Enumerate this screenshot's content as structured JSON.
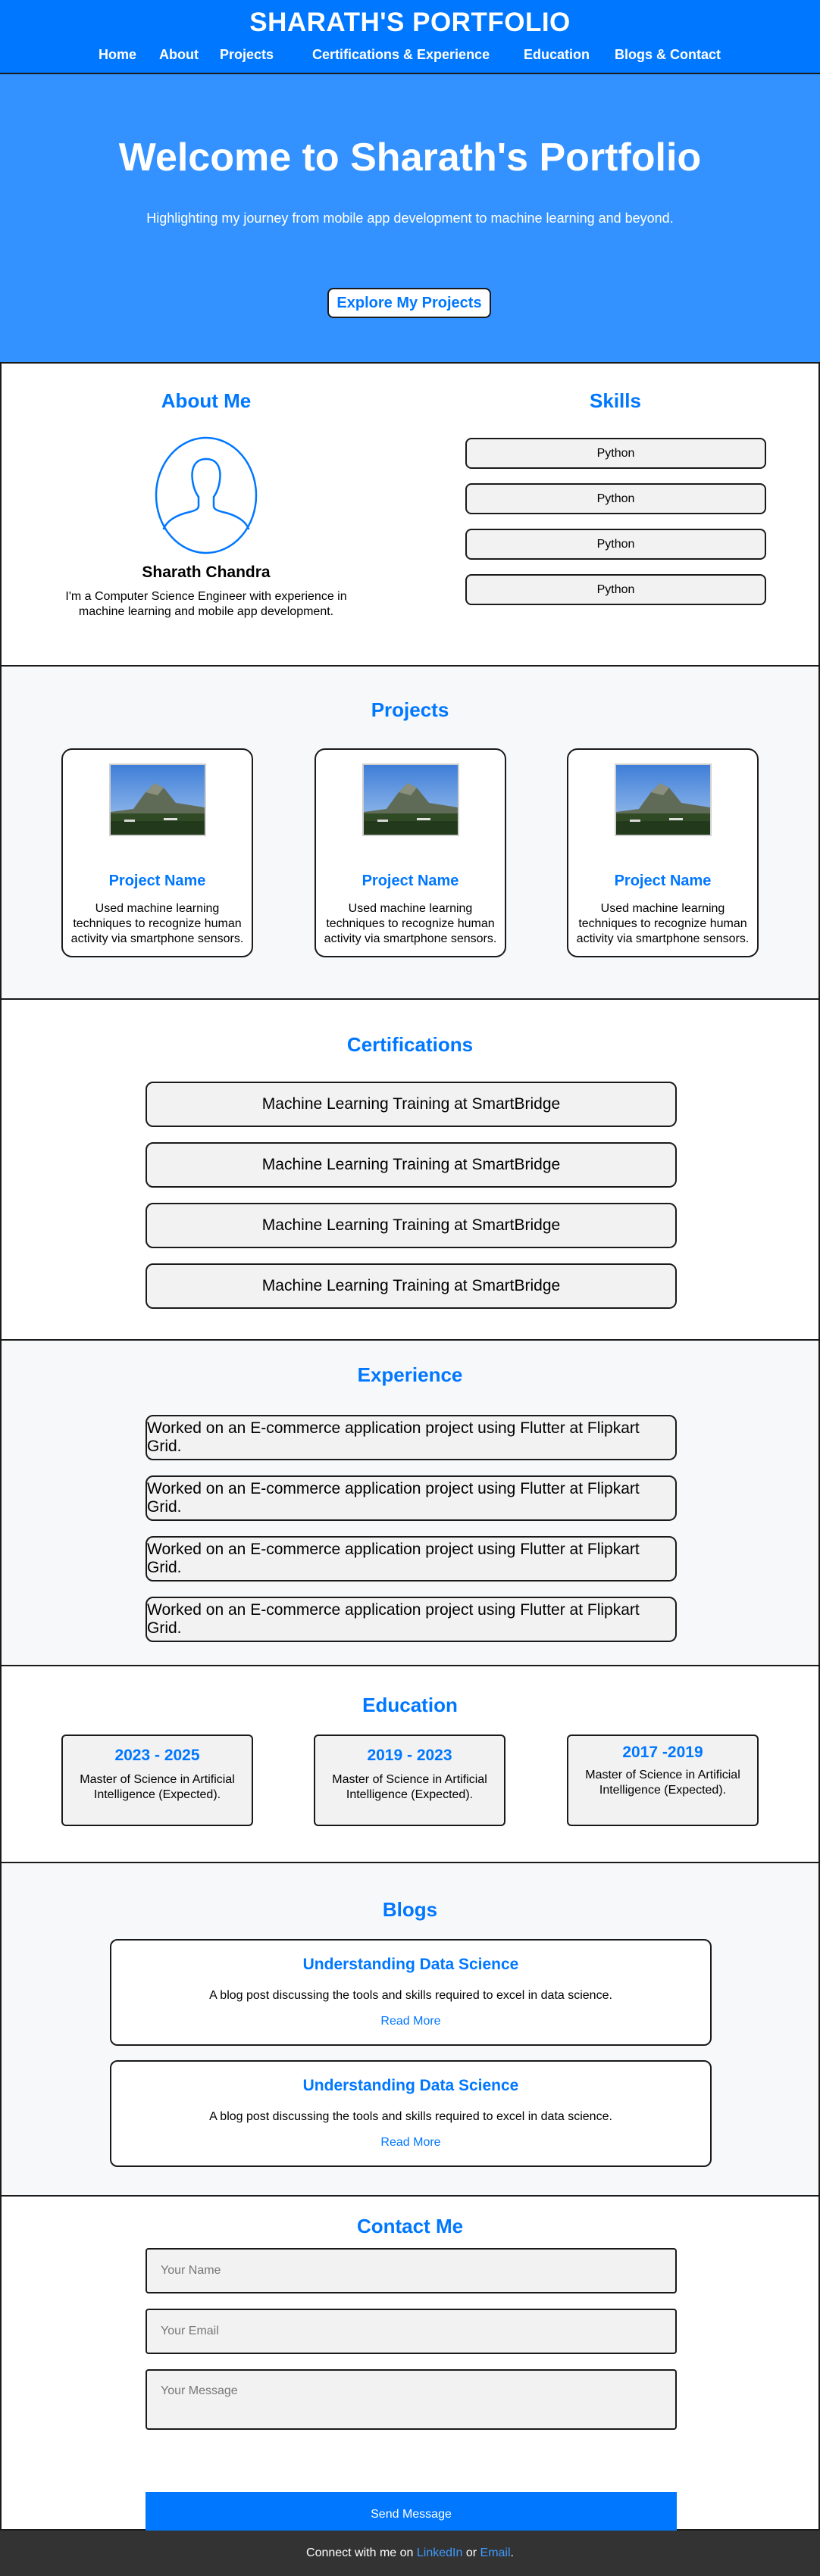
{
  "header": {
    "title": "SHARATH'S PORTFOLIO",
    "nav": [
      "Home",
      "About",
      "Projects",
      "Certifications & Experience",
      "Education",
      "Blogs & Contact"
    ]
  },
  "hero": {
    "title": "Welcome to Sharath's Portfolio",
    "subtitle": "Highlighting my journey from mobile app development to machine learning and beyond.",
    "button": "Explore My Projects"
  },
  "about": {
    "title": "About Me",
    "name": "Sharath Chandra",
    "description": "I'm a Computer Science Engineer with experience in machine learning and mobile app development."
  },
  "skills": {
    "title": "Skills",
    "items": [
      "Python",
      "Python",
      "Python",
      "Python"
    ]
  },
  "projects": {
    "title": "Projects",
    "items": [
      {
        "name": "Project Name",
        "description": "Used machine learning techniques to recognize human activity via smartphone sensors."
      },
      {
        "name": "Project Name",
        "description": "Used machine learning techniques to recognize human activity via smartphone sensors."
      },
      {
        "name": "Project Name",
        "description": "Used machine learning techniques to recognize human activity via smartphone sensors."
      }
    ]
  },
  "certifications": {
    "title": "Certifications",
    "items": [
      "Machine Learning Training at SmartBridge",
      "Machine Learning Training at SmartBridge",
      "Machine Learning Training at SmartBridge",
      "Machine Learning Training at SmartBridge"
    ]
  },
  "experience": {
    "title": "Experience",
    "items": [
      "Worked on an E-commerce application project using Flutter at Flipkart Grid.",
      "Worked on an E-commerce application project using Flutter at Flipkart Grid.",
      "Worked on an E-commerce application project using Flutter at Flipkart Grid.",
      "Worked on an E-commerce application project using Flutter at Flipkart Grid."
    ]
  },
  "education": {
    "title": "Education",
    "items": [
      {
        "years": "2023 - 2025",
        "description": "Master of Science in Artificial Intelligence (Expected)."
      },
      {
        "years": "2019 - 2023",
        "description": "Master of Science in Artificial Intelligence (Expected)."
      },
      {
        "years": "2017 -2019",
        "description": "Master of Science in Artificial Intelligence (Expected)."
      }
    ]
  },
  "blogs": {
    "title": "Blogs",
    "items": [
      {
        "title": "Understanding Data Science",
        "description": "A blog post discussing the tools and skills required to excel in data science.",
        "link": "Read  More"
      },
      {
        "title": "Understanding Data Science",
        "description": "A blog post discussing the tools and skills required to excel in data science.",
        "link": "Read  More"
      }
    ]
  },
  "contact": {
    "title": "Contact Me",
    "name_placeholder": "Your Name",
    "email_placeholder": "Your Email",
    "message_placeholder": "Your Message",
    "button": "Send Message"
  },
  "footer": {
    "prefix": "Connect  with me on",
    "linkedin": "LinkedIn",
    "or": "or",
    "email": "Email",
    "suffix": "."
  },
  "colors": {
    "accent": "#0077ff",
    "hero_bg": "#3392ff",
    "footer_bg": "#333333"
  }
}
